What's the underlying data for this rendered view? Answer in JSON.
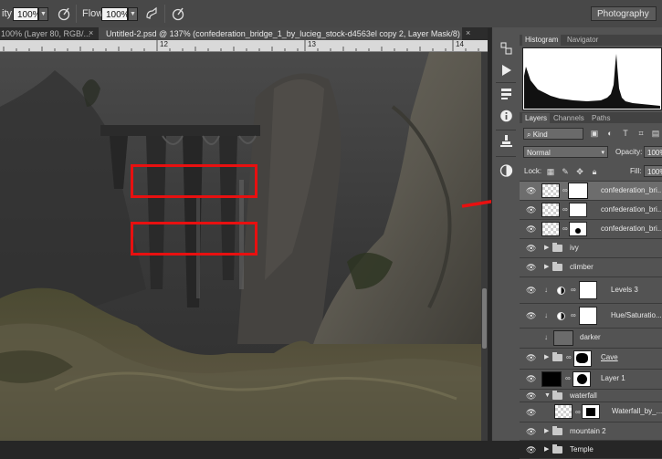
{
  "options_bar": {
    "opacity_label": "ity:",
    "opacity_value": "100%",
    "flow_label": "Flow:",
    "flow_value": "100%",
    "workspace": "Photography"
  },
  "tabs": [
    {
      "label": "100% (Layer 80, RGB/...",
      "close": "×",
      "active": false
    },
    {
      "label": "Untitled-2.psd @ 137% (confederation_bridge_1_by_lucieg_stock-d4563el copy 2, Layer Mask/8) *",
      "close": "×",
      "active": true
    }
  ],
  "ruler": {
    "marks": [
      "12",
      "13",
      "14"
    ]
  },
  "panel_tabs_top": [
    "Histogram",
    "Navigator"
  ],
  "panel_tabs_layers": [
    "Layers",
    "Channels",
    "Paths"
  ],
  "layers_controls": {
    "kind": "Kind",
    "blend_mode": "Normal",
    "opacity_label": "Opacity:",
    "opacity_value": "100%",
    "lock_label": "Lock:",
    "fill_label": "Fill:",
    "fill_value": "100%"
  },
  "layers": [
    {
      "name": "confederation_bri...",
      "type": "masked",
      "selected": true
    },
    {
      "name": "confederation_bri...",
      "type": "masked",
      "selected": false
    },
    {
      "name": "confederation_bri...",
      "type": "masked",
      "selected": false
    },
    {
      "name": "ivy",
      "type": "group",
      "selected": false
    },
    {
      "name": "climber",
      "type": "group",
      "selected": false
    },
    {
      "name": "Levels 3",
      "type": "adjustment",
      "selected": false
    },
    {
      "name": "Hue/Saturatio...",
      "type": "adjustment",
      "selected": false
    },
    {
      "name": "darker",
      "type": "clipped",
      "selected": false
    },
    {
      "name": "Cave",
      "type": "group-masked",
      "selected": false
    },
    {
      "name": "Layer 1",
      "type": "masked-black",
      "selected": false
    },
    {
      "name": "waterfall",
      "type": "group-open",
      "selected": false
    },
    {
      "name": "Waterfall_by_...",
      "type": "masked-sub",
      "selected": false
    },
    {
      "name": "mountain 2",
      "type": "group",
      "selected": false
    },
    {
      "name": "Temple",
      "type": "group",
      "selected": false
    }
  ],
  "annotations": {
    "color": "#e81010"
  },
  "icons": [
    "brush-icon",
    "airbrush-icon",
    "pressure-icon",
    "history-icon",
    "play-icon",
    "properties-icon",
    "info-icon",
    "adjust-icon",
    "color-icon",
    "eye-icon",
    "folder-icon",
    "link-icon",
    "lock-icon"
  ]
}
